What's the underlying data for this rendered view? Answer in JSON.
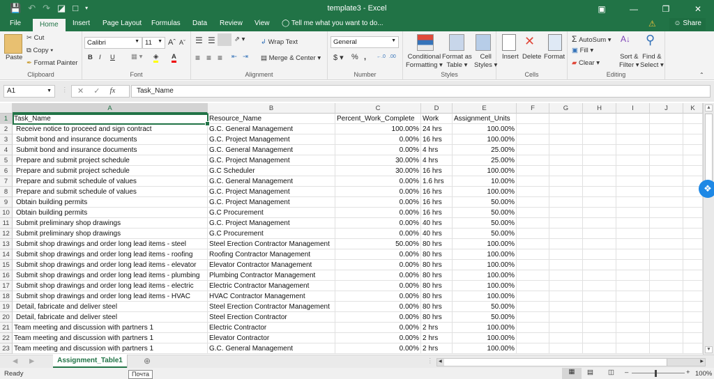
{
  "window": {
    "title": "template3 - Excel",
    "qat_icons": [
      "save-icon",
      "undo-icon",
      "redo-icon",
      "print-preview-icon",
      "new-file-icon",
      "customize-qat-icon"
    ],
    "controls": [
      "ribbon-display-icon",
      "minimize-icon",
      "restore-icon",
      "close-icon"
    ]
  },
  "tabs": [
    {
      "label": "File"
    },
    {
      "label": "Home",
      "active": true
    },
    {
      "label": "Insert"
    },
    {
      "label": "Page Layout"
    },
    {
      "label": "Formulas"
    },
    {
      "label": "Data"
    },
    {
      "label": "Review"
    },
    {
      "label": "View"
    }
  ],
  "tell_me": "Tell me what you want to do...",
  "share": "Share",
  "ribbon": {
    "clipboard": {
      "label": "Clipboard",
      "paste": "Paste",
      "cut": "Cut",
      "copy": "Copy",
      "format_painter": "Format Painter"
    },
    "font": {
      "label": "Font",
      "name": "Calibri",
      "size": "11",
      "bold": "B",
      "italic": "I",
      "underline": "U"
    },
    "alignment": {
      "label": "Alignment",
      "wrap_text": "Wrap Text",
      "merge_center": "Merge & Center"
    },
    "number": {
      "label": "Number",
      "format": "General",
      "currency": "$",
      "percent": "%",
      "comma": ","
    },
    "styles": {
      "label": "Styles",
      "conditional": "Conditional",
      "formatting": "Formatting",
      "format_as": "Format as",
      "table": "Table",
      "cell": "Cell",
      "styles": "Styles"
    },
    "cells": {
      "label": "Cells",
      "insert": "Insert",
      "delete": "Delete",
      "format": "Format"
    },
    "editing": {
      "label": "Editing",
      "autosum": "AutoSum",
      "fill": "Fill",
      "clear": "Clear",
      "sort": "Sort &",
      "filter": "Filter",
      "find": "Find &",
      "select": "Select"
    }
  },
  "formula_bar": {
    "name_box": "A1",
    "formula": "Task_Name"
  },
  "columns": [
    "A",
    "B",
    "C",
    "D",
    "E",
    "F",
    "G",
    "H",
    "I",
    "J",
    "K"
  ],
  "rows": [
    [
      "Task_Name",
      "Resource_Name",
      "Percent_Work_Complete",
      "Work",
      "Assignment_Units"
    ],
    [
      "Receive notice to proceed and sign contract",
      "G.C. General Management",
      "100.00%",
      "24 hrs",
      "100.00%"
    ],
    [
      "Submit bond and insurance documents",
      "G.C. Project Management",
      "0.00%",
      "16 hrs",
      "100.00%"
    ],
    [
      "Submit bond and insurance documents",
      "G.C. General Management",
      "0.00%",
      "4 hrs",
      "25.00%"
    ],
    [
      "Prepare and submit project schedule",
      "G.C. Project Management",
      "30.00%",
      "4 hrs",
      "25.00%"
    ],
    [
      "Prepare and submit project schedule",
      "G.C Scheduler",
      "30.00%",
      "16 hrs",
      "100.00%"
    ],
    [
      "Prepare and submit schedule of values",
      "G.C. General Management",
      "0.00%",
      "1.6 hrs",
      "10.00%"
    ],
    [
      "Prepare and submit schedule of values",
      "G.C. Project Management",
      "0.00%",
      "16 hrs",
      "100.00%"
    ],
    [
      "Obtain building permits",
      "G.C. Project Management",
      "0.00%",
      "16 hrs",
      "50.00%"
    ],
    [
      "Obtain building permits",
      "G.C Procurement",
      "0.00%",
      "16 hrs",
      "50.00%"
    ],
    [
      "Submit preliminary shop drawings",
      "G.C. Project Management",
      "0.00%",
      "40 hrs",
      "50.00%"
    ],
    [
      "Submit preliminary shop drawings",
      "G.C Procurement",
      "0.00%",
      "40 hrs",
      "50.00%"
    ],
    [
      "Submit shop drawings and order long lead items - steel",
      "Steel Erection Contractor Management",
      "50.00%",
      "80 hrs",
      "100.00%"
    ],
    [
      "Submit shop drawings and order long lead items - roofing",
      "Roofing Contractor Management",
      "0.00%",
      "80 hrs",
      "100.00%"
    ],
    [
      "Submit shop drawings and order long lead items - elevator",
      "Elevator Contractor Management",
      "0.00%",
      "80 hrs",
      "100.00%"
    ],
    [
      "Submit shop drawings and order long lead items - plumbing",
      "Plumbing Contractor Management",
      "0.00%",
      "80 hrs",
      "100.00%"
    ],
    [
      "Submit shop drawings and order long lead items - electric",
      "Electric Contractor Management",
      "0.00%",
      "80 hrs",
      "100.00%"
    ],
    [
      "Submit shop drawings and order long lead items - HVAC",
      "HVAC Contractor Management",
      "0.00%",
      "80 hrs",
      "100.00%"
    ],
    [
      "Detail, fabricate and deliver steel",
      "Steel Erection Contractor Management",
      "0.00%",
      "80 hrs",
      "50.00%"
    ],
    [
      "Detail, fabricate and deliver steel",
      "Steel Erection Contractor",
      "0.00%",
      "80 hrs",
      "50.00%"
    ],
    [
      "Team meeting and discussion with partners 1",
      "Electric Contractor",
      "0.00%",
      "2 hrs",
      "100.00%"
    ],
    [
      "Team meeting and discussion with partners 1",
      "Elevator Contractor",
      "0.00%",
      "2 hrs",
      "100.00%"
    ],
    [
      "Team meeting and discussion with partners 1",
      "G.C. General Management",
      "0.00%",
      "2 hrs",
      "100.00%"
    ]
  ],
  "sheet_tab": "Assignment_Table1",
  "status": {
    "ready": "Ready",
    "tooltip": "Почта",
    "zoom": "100%"
  }
}
